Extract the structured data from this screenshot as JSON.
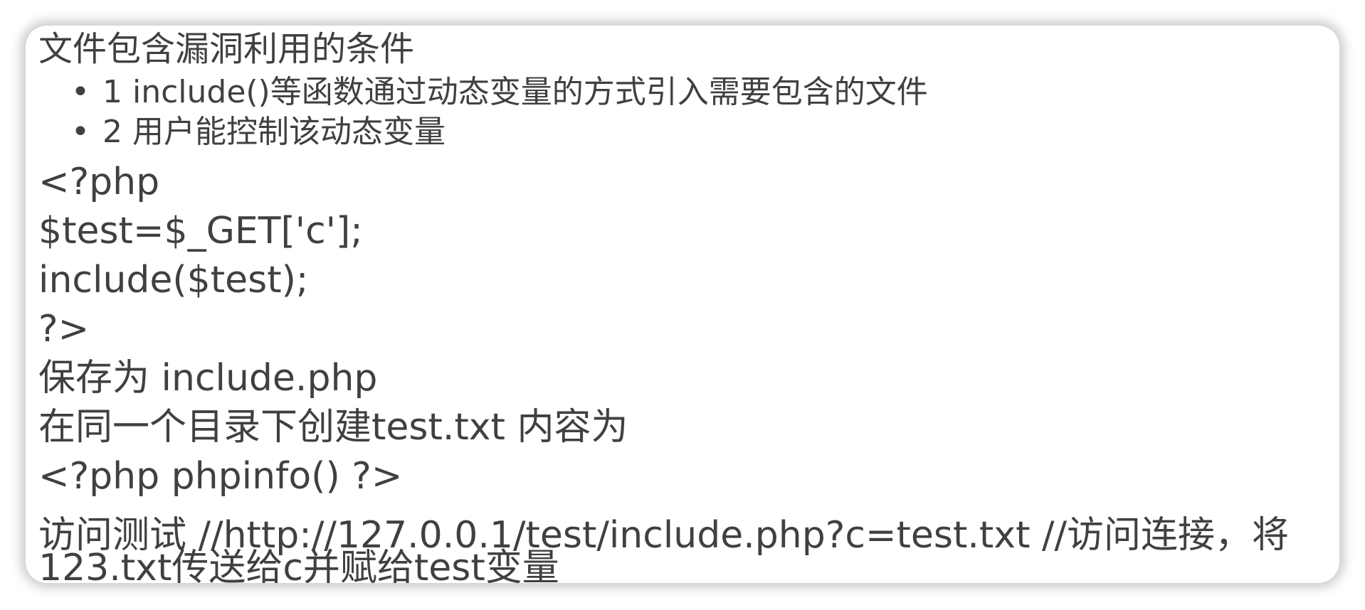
{
  "slide": {
    "heading": "文件包含漏洞利用的条件",
    "bullets": [
      "1 include()等函数通过动态变量的方式引入需要包含的文件",
      "2 用户能控制该动态变量"
    ],
    "bullet_marker": "•",
    "code_lines": [
      "<?php",
      "$test=$_GET['c'];",
      "include($test);",
      "?>",
      "保存为 include.php",
      "在同一个目录下创建test.txt 内容为",
      "<?php phpinfo() ?>"
    ],
    "access_line_1": "访问测试  //http://127.0.0.1/test/include.php?c=test.txt     //访问连接，将",
    "access_line_2": "123.txt传送给c并赋给test变量"
  }
}
